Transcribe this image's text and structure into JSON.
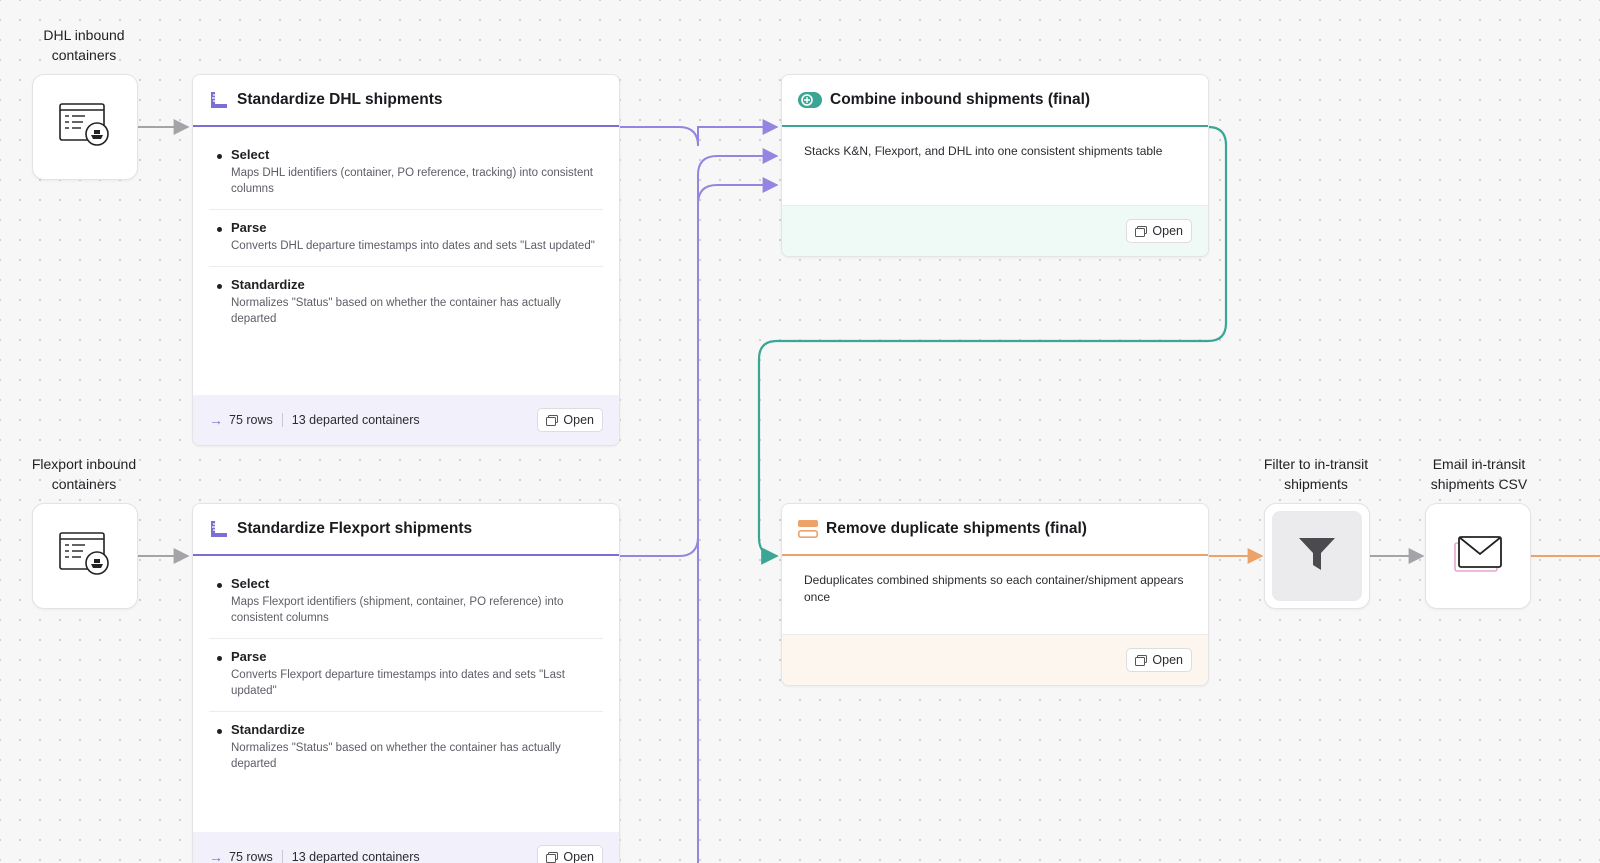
{
  "sources": [
    {
      "label": "DHL inbound\ncontainers",
      "icon": "table-ship-icon"
    },
    {
      "label": "Flexport inbound\ncontainers",
      "icon": "table-ship-icon"
    }
  ],
  "cards": {
    "dhl": {
      "title": "Standardize DHL shipments",
      "icon": "ruler-icon",
      "steps": [
        {
          "name": "Select",
          "desc": "Maps DHL identifiers (container, PO reference, tracking) into consistent columns"
        },
        {
          "name": "Parse",
          "desc": "Converts DHL departure timestamps into dates and sets \"Last updated\""
        },
        {
          "name": "Standardize",
          "desc": "Normalizes \"Status\" based on whether the container has actually departed"
        }
      ],
      "rows": "75 rows",
      "departed": "13 departed containers",
      "open_label": "Open"
    },
    "flexport": {
      "title": "Standardize Flexport shipments",
      "icon": "ruler-icon",
      "steps": [
        {
          "name": "Select",
          "desc": "Maps Flexport identifiers (shipment, container, PO reference) into consistent columns"
        },
        {
          "name": "Parse",
          "desc": "Converts Flexport departure timestamps into dates and sets \"Last updated\""
        },
        {
          "name": "Standardize",
          "desc": "Normalizes \"Status\" based on whether the container has actually departed"
        }
      ],
      "rows": "75 rows",
      "departed": "13 departed containers",
      "open_label": "Open"
    },
    "combine": {
      "title": "Combine inbound shipments (final)",
      "icon": "combine-icon",
      "desc": "Stacks K&N, Flexport, and DHL into one consistent shipments table",
      "open_label": "Open",
      "accent": "#3aa693",
      "footer_bg": "#effaf6"
    },
    "dedupe": {
      "title": "Remove duplicate shipments (final)",
      "icon": "dedupe-icon",
      "desc": "Deduplicates combined shipments so each container/shipment appears once",
      "open_label": "Open",
      "accent": "#eda26a",
      "footer_bg": "#fcf6ee"
    }
  },
  "actions": [
    {
      "label": "Filter to in-transit\nshipments",
      "icon": "filter-icon"
    },
    {
      "label": "Email in-transit\nshipments CSV",
      "icon": "email-icon"
    }
  ],
  "colors": {
    "purple": "#9486e0",
    "purple_dark": "#7b6fd6",
    "teal": "#3aa693",
    "orange": "#eda26a",
    "gray_wire": "#a3a3a8"
  }
}
